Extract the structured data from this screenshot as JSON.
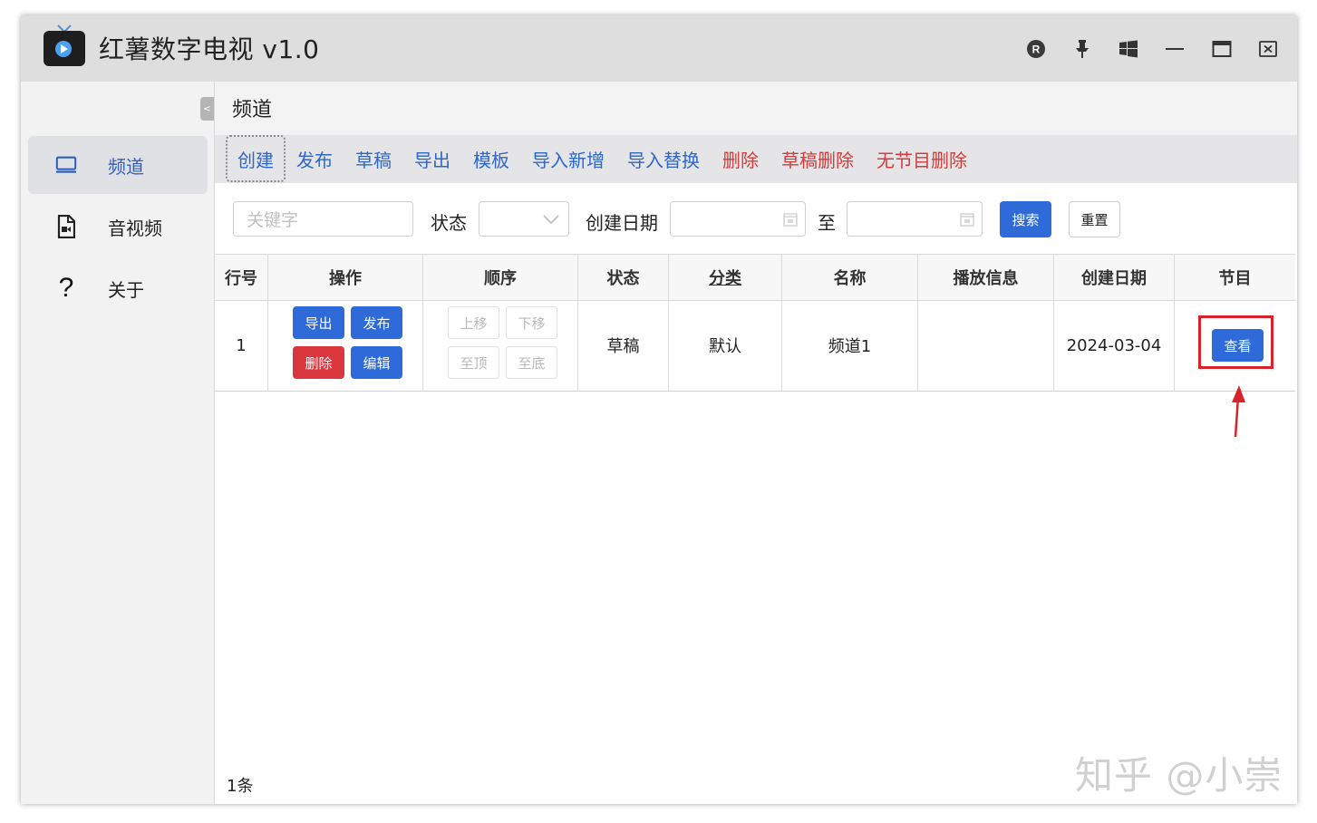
{
  "window": {
    "title": "红薯数字电视 v1.0",
    "controls": {
      "r_badge": "R"
    }
  },
  "sidebar": {
    "collapse_glyph": "<",
    "items": [
      {
        "label": "频道",
        "icon": "monitor-icon",
        "active": true
      },
      {
        "label": "音视频",
        "icon": "video-file-icon",
        "active": false
      },
      {
        "label": "关于",
        "icon": "question-icon",
        "active": false
      }
    ]
  },
  "page": {
    "title": "频道"
  },
  "toolbar": {
    "buttons": [
      {
        "label": "创建",
        "color": "#2f66c9"
      },
      {
        "label": "发布",
        "color": "#2f66c9"
      },
      {
        "label": "草稿",
        "color": "#2f66c9"
      },
      {
        "label": "导出",
        "color": "#2f66c9"
      },
      {
        "label": "模板",
        "color": "#2f66c9"
      },
      {
        "label": "导入新增",
        "color": "#2f66c9"
      },
      {
        "label": "导入替换",
        "color": "#2f66c9"
      },
      {
        "label": "删除",
        "color": "#d23b3b"
      },
      {
        "label": "草稿删除",
        "color": "#d23b3b"
      },
      {
        "label": "无节目删除",
        "color": "#d23b3b"
      }
    ]
  },
  "search": {
    "keyword_placeholder": "关键字",
    "status_label": "状态",
    "date_label": "创建日期",
    "to_label": "至",
    "search_button": "搜索",
    "reset_button": "重置"
  },
  "table": {
    "headers": [
      "行号",
      "操作",
      "顺序",
      "状态",
      "分类",
      "名称",
      "播放信息",
      "创建日期",
      "节目"
    ],
    "rows": [
      {
        "index": "1",
        "actions": {
          "export": "导出",
          "publish": "发布",
          "delete": "删除",
          "edit": "编辑"
        },
        "order": {
          "up": "上移",
          "down": "下移",
          "top": "至顶",
          "bottom": "至底"
        },
        "status": "草稿",
        "category": "默认",
        "name": "频道1",
        "play_info": "",
        "created": "2024-03-04",
        "program_button": "查看"
      }
    ]
  },
  "footer": {
    "count": "1条"
  },
  "watermark": "知乎 @小崇",
  "colors": {
    "accent": "#2e6ad8",
    "danger": "#d9363e",
    "link": "#2f66c9",
    "highlight": "#d8232a"
  }
}
